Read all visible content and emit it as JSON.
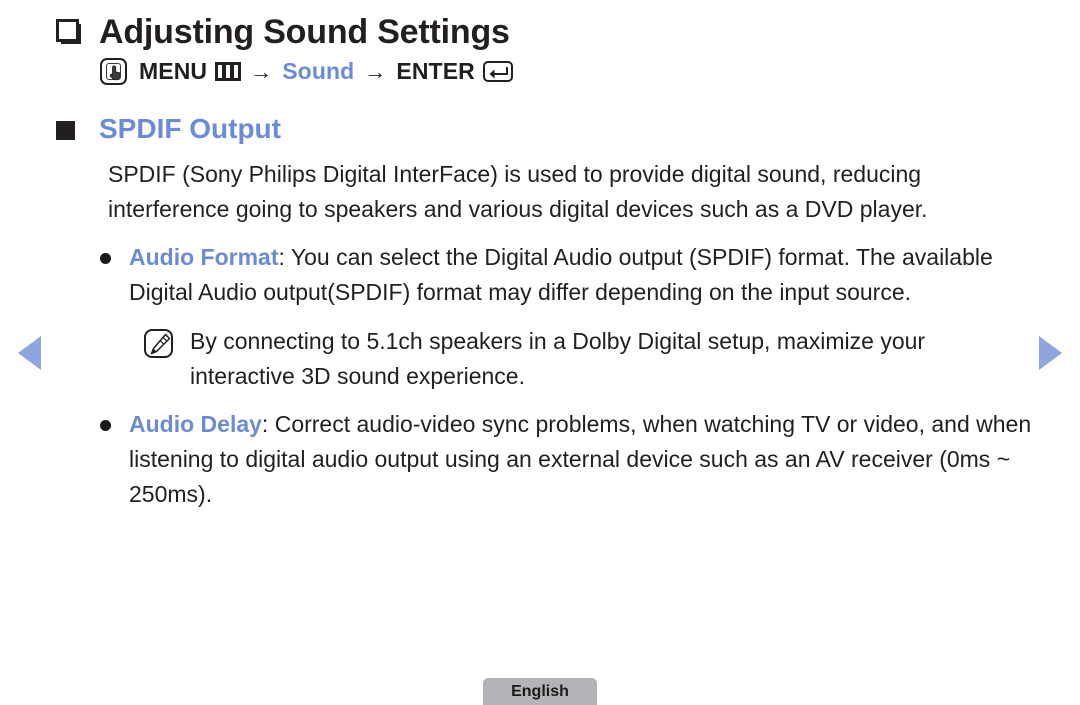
{
  "title": {
    "text": "Adjusting Sound Settings",
    "bullet_icon": "stacked-square-icon"
  },
  "menu_path": {
    "press_icon": "press-hand-icon",
    "menu_label": "MENU",
    "menu_icon": "menu-bars-icon",
    "arrow1": "→",
    "sound_label": "Sound",
    "arrow2": "→",
    "enter_label": "ENTER",
    "enter_icon": "enter-return-icon"
  },
  "section": {
    "heading": "SPDIF Output",
    "intro": "SPDIF (Sony Philips Digital InterFace) is used to provide digital sound, reducing interference going to speakers and various digital devices such as a DVD player.",
    "bullets": [
      {
        "keyword": "Audio Format",
        "separator": ": ",
        "text": "You can select the Digital Audio output (SPDIF) format. The available Digital Audio output(SPDIF) format may differ depending on the input source.",
        "note": {
          "icon": "note-pencil-icon",
          "text": "By connecting to 5.1ch speakers in a Dolby Digital setup, maximize your interactive 3D sound experience."
        }
      },
      {
        "keyword": "Audio Delay",
        "separator": ": ",
        "text": "Correct audio-video sync problems, when watching TV or video, and when listening to digital audio output using an external device such as an AV receiver (0ms ~ 250ms)."
      }
    ]
  },
  "navigation": {
    "prev_icon": "triangle-left-icon",
    "next_icon": "triangle-right-icon"
  },
  "footer": {
    "language_label": "English"
  },
  "colors": {
    "accent_blue": "#6b8bd6",
    "nav_arrow_blue": "#8ea5de",
    "text_black": "#231f20",
    "footer_gray": "#b3b3b8"
  }
}
